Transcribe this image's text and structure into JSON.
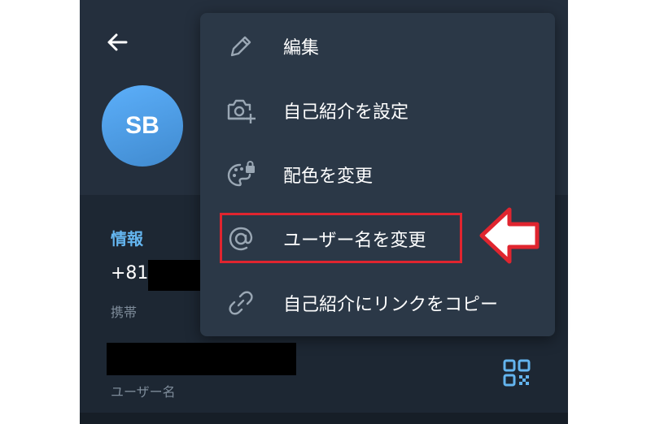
{
  "profile": {
    "avatar_initials": "SB",
    "info_title": "情報",
    "phone_prefix": "+81",
    "phone_label": "携帯",
    "username_label": "ユーザー名"
  },
  "menu": {
    "items": [
      {
        "label": "編集",
        "icon": "pencil-icon"
      },
      {
        "label": "自己紹介を設定",
        "icon": "camera-add-icon"
      },
      {
        "label": "配色を変更",
        "icon": "palette-lock-icon"
      },
      {
        "label": "ユーザー名を変更",
        "icon": "at-sign-icon"
      },
      {
        "label": "自己紹介にリンクをコピー",
        "icon": "link-icon"
      }
    ]
  },
  "colors": {
    "header_bg": "#242f3d",
    "content_bg": "#1d2733",
    "menu_bg": "#2b3847",
    "accent": "#64b5ef",
    "highlight": "#e0252f"
  }
}
